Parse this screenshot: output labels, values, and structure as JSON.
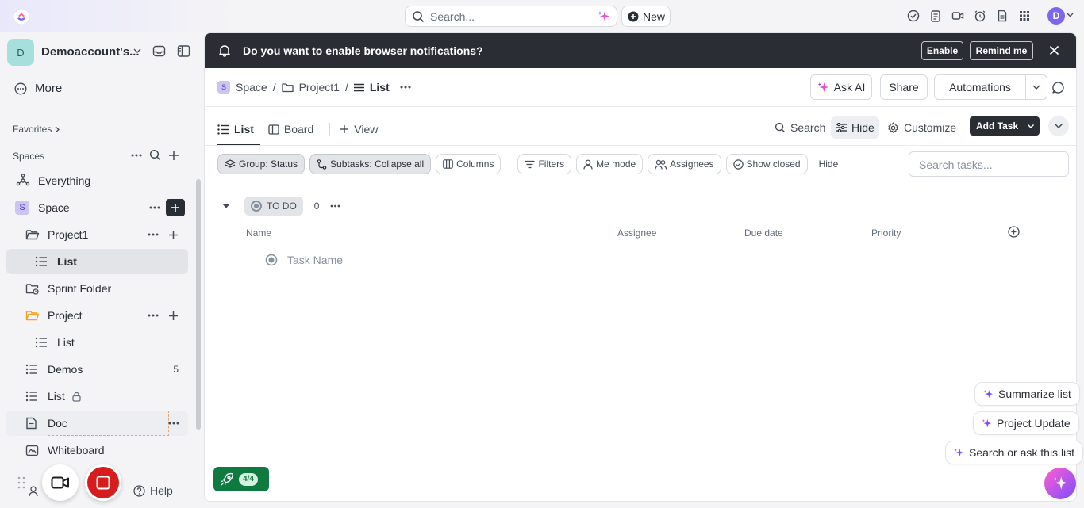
{
  "topbar": {
    "search_placeholder": "Search...",
    "new_label": "New",
    "user_initial": "D"
  },
  "sidebar": {
    "workspace_initial": "D",
    "workspace_name": "Demoaccount's...",
    "more_label": "More",
    "favorites_label": "Favorites",
    "spaces_label": "Spaces",
    "items": [
      {
        "label": "Everything"
      },
      {
        "label": "Space",
        "badge": "S"
      },
      {
        "label": "Project1"
      },
      {
        "label": "List",
        "selected": true
      },
      {
        "label": "Sprint Folder"
      },
      {
        "label": "Project"
      },
      {
        "label": "List"
      },
      {
        "label": "Demos",
        "count": "5"
      },
      {
        "label": "List"
      },
      {
        "label": "Doc"
      },
      {
        "label": "Whiteboard"
      }
    ],
    "help_label": "Help"
  },
  "notification": {
    "message": "Do you want to enable browser notifications?",
    "enable_label": "Enable",
    "remind_label": "Remind me"
  },
  "header": {
    "breadcrumb": {
      "space_badge": "S",
      "space": "Space",
      "sep": "/",
      "folder": "Project1",
      "list": "List"
    },
    "ask_ai_label": "Ask AI",
    "share_label": "Share",
    "automations_label": "Automations"
  },
  "views": {
    "list_label": "List",
    "board_label": "Board",
    "add_view_label": "View",
    "search_label": "Search",
    "hide_label": "Hide",
    "customize_label": "Customize",
    "add_task_label": "Add Task"
  },
  "filters": {
    "group_label": "Group: Status",
    "subtasks_label": "Subtasks: Collapse all",
    "columns_label": "Columns",
    "filters_label": "Filters",
    "me_mode_label": "Me mode",
    "assignees_label": "Assignees",
    "show_closed_label": "Show closed",
    "hide_label": "Hide",
    "search_placeholder": "Search tasks..."
  },
  "group": {
    "status_label": "TO DO",
    "count": "0",
    "columns": [
      "Name",
      "Assignee",
      "Due date",
      "Priority"
    ],
    "task_placeholder": "Task Name"
  },
  "ai_suggestions": {
    "summarize": "Summarize list",
    "project_update": "Project Update",
    "search_ask": "Search or ask this list"
  },
  "onboarding": {
    "progress": "4/4"
  },
  "colors": {
    "accent": "#7b68ee",
    "dark": "#2a2e34",
    "record": "#d61c1c",
    "onboarding_green": "#0f7a3f"
  }
}
